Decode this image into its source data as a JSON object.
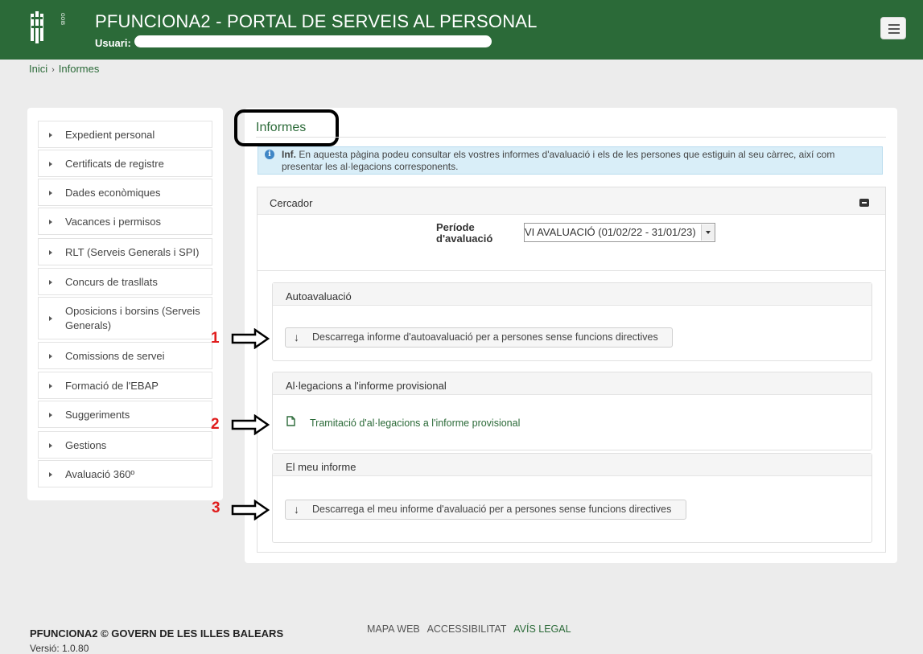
{
  "header": {
    "title": "PFUNCIONA2 - PORTAL DE SERVEIS AL PERSONAL",
    "user_label": "Usuari:",
    "logo_text": "GOIB"
  },
  "breadcrumb": [
    "Inici",
    "Informes"
  ],
  "sidebar": {
    "items": [
      {
        "label": "Expedient personal"
      },
      {
        "label": "Certificats de registre"
      },
      {
        "label": "Dades econòmiques"
      },
      {
        "label": "Vacances i permisos"
      },
      {
        "label": "RLT (Serveis Generals i SPI)"
      },
      {
        "label": "Concurs de trasllats"
      },
      {
        "label": "Oposicions i borsins (Serveis Generals)"
      },
      {
        "label": "Comissions de servei"
      },
      {
        "label": "Formació de l'EBAP"
      },
      {
        "label": "Suggeriments"
      },
      {
        "label": "Gestions"
      },
      {
        "label": "Avaluació 360º"
      }
    ]
  },
  "main": {
    "title": "Informes",
    "info": {
      "strong": "Inf.",
      "text": "En aquesta pàgina podeu consultar els vostres informes d'avaluació i els de les persones que estiguin al seu càrrec, així com presentar les al·legacions corresponents."
    },
    "search": {
      "title": "Cercador",
      "period_label_1": "Període",
      "period_label_2": "d'avaluació",
      "period_value": "VI AVALUACIÓ (01/02/22 - 31/01/23)"
    },
    "sections": {
      "self": {
        "title": "Autoavaluació",
        "button": "Descarrega informe d'autoavaluació per a persones sense funcions directives"
      },
      "allegations": {
        "title": "Al·legacions a l'informe provisional",
        "link": "Tramitació d'al·legacions a l'informe provisional"
      },
      "report": {
        "title": "El meu informe",
        "button": "Descarrega el meu informe d'avaluació per a persones sense funcions directives"
      }
    }
  },
  "annotations": [
    "1",
    "2",
    "3"
  ],
  "footer": {
    "copyright": "PFUNCIONA2 © GOVERN DE LES ILLES BALEARS",
    "version": "Versió: 1.0.80",
    "links": [
      "MAPA WEB",
      "ACCESSIBILITAT",
      "AVÍS LEGAL"
    ]
  },
  "colors": {
    "brand_green": "#2b6a38",
    "annotation_red": "#e01c1c",
    "info_bg": "#d9eef8"
  },
  "icons": {
    "info": "info-icon",
    "menu": "hamburger-icon",
    "download": "arrow-down-icon",
    "document": "document-icon"
  }
}
